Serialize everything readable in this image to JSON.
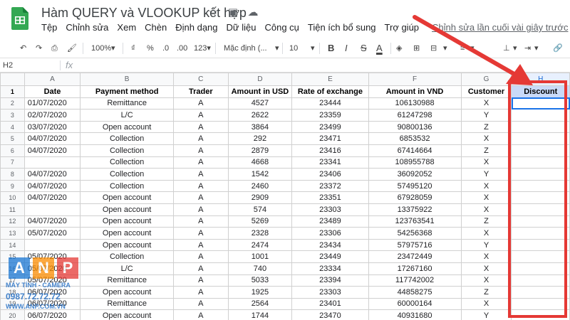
{
  "app": {
    "title": "Hàm QUERY và VLOOKUP kết hợp",
    "menus": [
      "Tệp",
      "Chỉnh sửa",
      "Xem",
      "Chèn",
      "Định dạng",
      "Dữ liệu",
      "Công cụ",
      "Tiện ích bổ sung",
      "Trợ giúp"
    ],
    "last_edit": "Chỉnh sửa lần cuối vài giây trước"
  },
  "toolbar": {
    "zoom": "100%",
    "currency": "₫",
    "percent": "%",
    "decimal_less": ".0",
    "decimal_more": ".00",
    "format_more": "123▾",
    "font": "Mặc định (...",
    "font_size": "10",
    "bold": "B",
    "italic": "I",
    "strike": "S",
    "text_color": "A"
  },
  "formula_bar": {
    "cell_ref": "H2",
    "fx": "fx",
    "value": ""
  },
  "columns": [
    "A",
    "B",
    "C",
    "D",
    "E",
    "F",
    "G",
    "H"
  ],
  "header_row": [
    "Date",
    "Payment method",
    "Trader",
    "Amount in USD",
    "Rate of exchange",
    "Amount in VND",
    "Customer",
    "Discount"
  ],
  "rows": [
    {
      "n": "2",
      "date": "01/07/2020",
      "method": "Remittance",
      "trader": "A",
      "usd": "4527",
      "rate": "23444",
      "vnd": "106130988",
      "cust": "X",
      "disc": ""
    },
    {
      "n": "3",
      "date": "02/07/2020",
      "method": "L/C",
      "trader": "A",
      "usd": "2622",
      "rate": "23359",
      "vnd": "61247298",
      "cust": "Y",
      "disc": ""
    },
    {
      "n": "4",
      "date": "03/07/2020",
      "method": "Open account",
      "trader": "A",
      "usd": "3864",
      "rate": "23499",
      "vnd": "90800136",
      "cust": "Z",
      "disc": ""
    },
    {
      "n": "5",
      "date": "04/07/2020",
      "method": "Collection",
      "trader": "A",
      "usd": "292",
      "rate": "23471",
      "vnd": "6853532",
      "cust": "X",
      "disc": ""
    },
    {
      "n": "6",
      "date": "04/07/2020",
      "method": "Collection",
      "trader": "A",
      "usd": "2879",
      "rate": "23416",
      "vnd": "67414664",
      "cust": "Z",
      "disc": ""
    },
    {
      "n": "7",
      "date": "",
      "method": "Collection",
      "trader": "A",
      "usd": "4668",
      "rate": "23341",
      "vnd": "108955788",
      "cust": "X",
      "disc": ""
    },
    {
      "n": "8",
      "date": "04/07/2020",
      "method": "Collection",
      "trader": "A",
      "usd": "1542",
      "rate": "23406",
      "vnd": "36092052",
      "cust": "Y",
      "disc": ""
    },
    {
      "n": "9",
      "date": "04/07/2020",
      "method": "Collection",
      "trader": "A",
      "usd": "2460",
      "rate": "23372",
      "vnd": "57495120",
      "cust": "X",
      "disc": ""
    },
    {
      "n": "10",
      "date": "04/07/2020",
      "method": "Open account",
      "trader": "A",
      "usd": "2909",
      "rate": "23351",
      "vnd": "67928059",
      "cust": "X",
      "disc": ""
    },
    {
      "n": "11",
      "date": "",
      "method": "Open account",
      "trader": "A",
      "usd": "574",
      "rate": "23303",
      "vnd": "13375922",
      "cust": "X",
      "disc": ""
    },
    {
      "n": "12",
      "date": "04/07/2020",
      "method": "Open account",
      "trader": "A",
      "usd": "5269",
      "rate": "23489",
      "vnd": "123763541",
      "cust": "Z",
      "disc": ""
    },
    {
      "n": "13",
      "date": "05/07/2020",
      "method": "Open account",
      "trader": "A",
      "usd": "2328",
      "rate": "23306",
      "vnd": "54256368",
      "cust": "X",
      "disc": ""
    },
    {
      "n": "14",
      "date": "",
      "method": "Open account",
      "trader": "A",
      "usd": "2474",
      "rate": "23434",
      "vnd": "57975716",
      "cust": "Y",
      "disc": ""
    },
    {
      "n": "15",
      "date": "05/07/2020",
      "method": "Collection",
      "trader": "A",
      "usd": "1001",
      "rate": "23449",
      "vnd": "23472449",
      "cust": "X",
      "disc": ""
    },
    {
      "n": "16",
      "date": "05/07/2020",
      "method": "L/C",
      "trader": "A",
      "usd": "740",
      "rate": "23334",
      "vnd": "17267160",
      "cust": "X",
      "disc": ""
    },
    {
      "n": "17",
      "date": "05/07/2020",
      "method": "Remittance",
      "trader": "A",
      "usd": "5033",
      "rate": "23394",
      "vnd": "117742002",
      "cust": "X",
      "disc": ""
    },
    {
      "n": "18",
      "date": "06/07/2020",
      "method": "Open account",
      "trader": "A",
      "usd": "1925",
      "rate": "23303",
      "vnd": "44858275",
      "cust": "Z",
      "disc": ""
    },
    {
      "n": "19",
      "date": "06/07/2020",
      "method": "Remittance",
      "trader": "A",
      "usd": "2564",
      "rate": "23401",
      "vnd": "60000164",
      "cust": "X",
      "disc": ""
    },
    {
      "n": "20",
      "date": "06/07/2020",
      "method": "Open account",
      "trader": "A",
      "usd": "1744",
      "rate": "23470",
      "vnd": "40931680",
      "cust": "Y",
      "disc": ""
    }
  ],
  "watermark": {
    "letters": [
      "A",
      "N",
      "P"
    ],
    "line1": "MÁY TÍNH - CAMERA",
    "line2": "0987.72.72.72",
    "line3": "WWW.ANP.COM.VN"
  },
  "colors": {
    "annotation_red": "#e53935",
    "selection_blue": "#1a73e8",
    "discount_header": "#c9daf8"
  }
}
